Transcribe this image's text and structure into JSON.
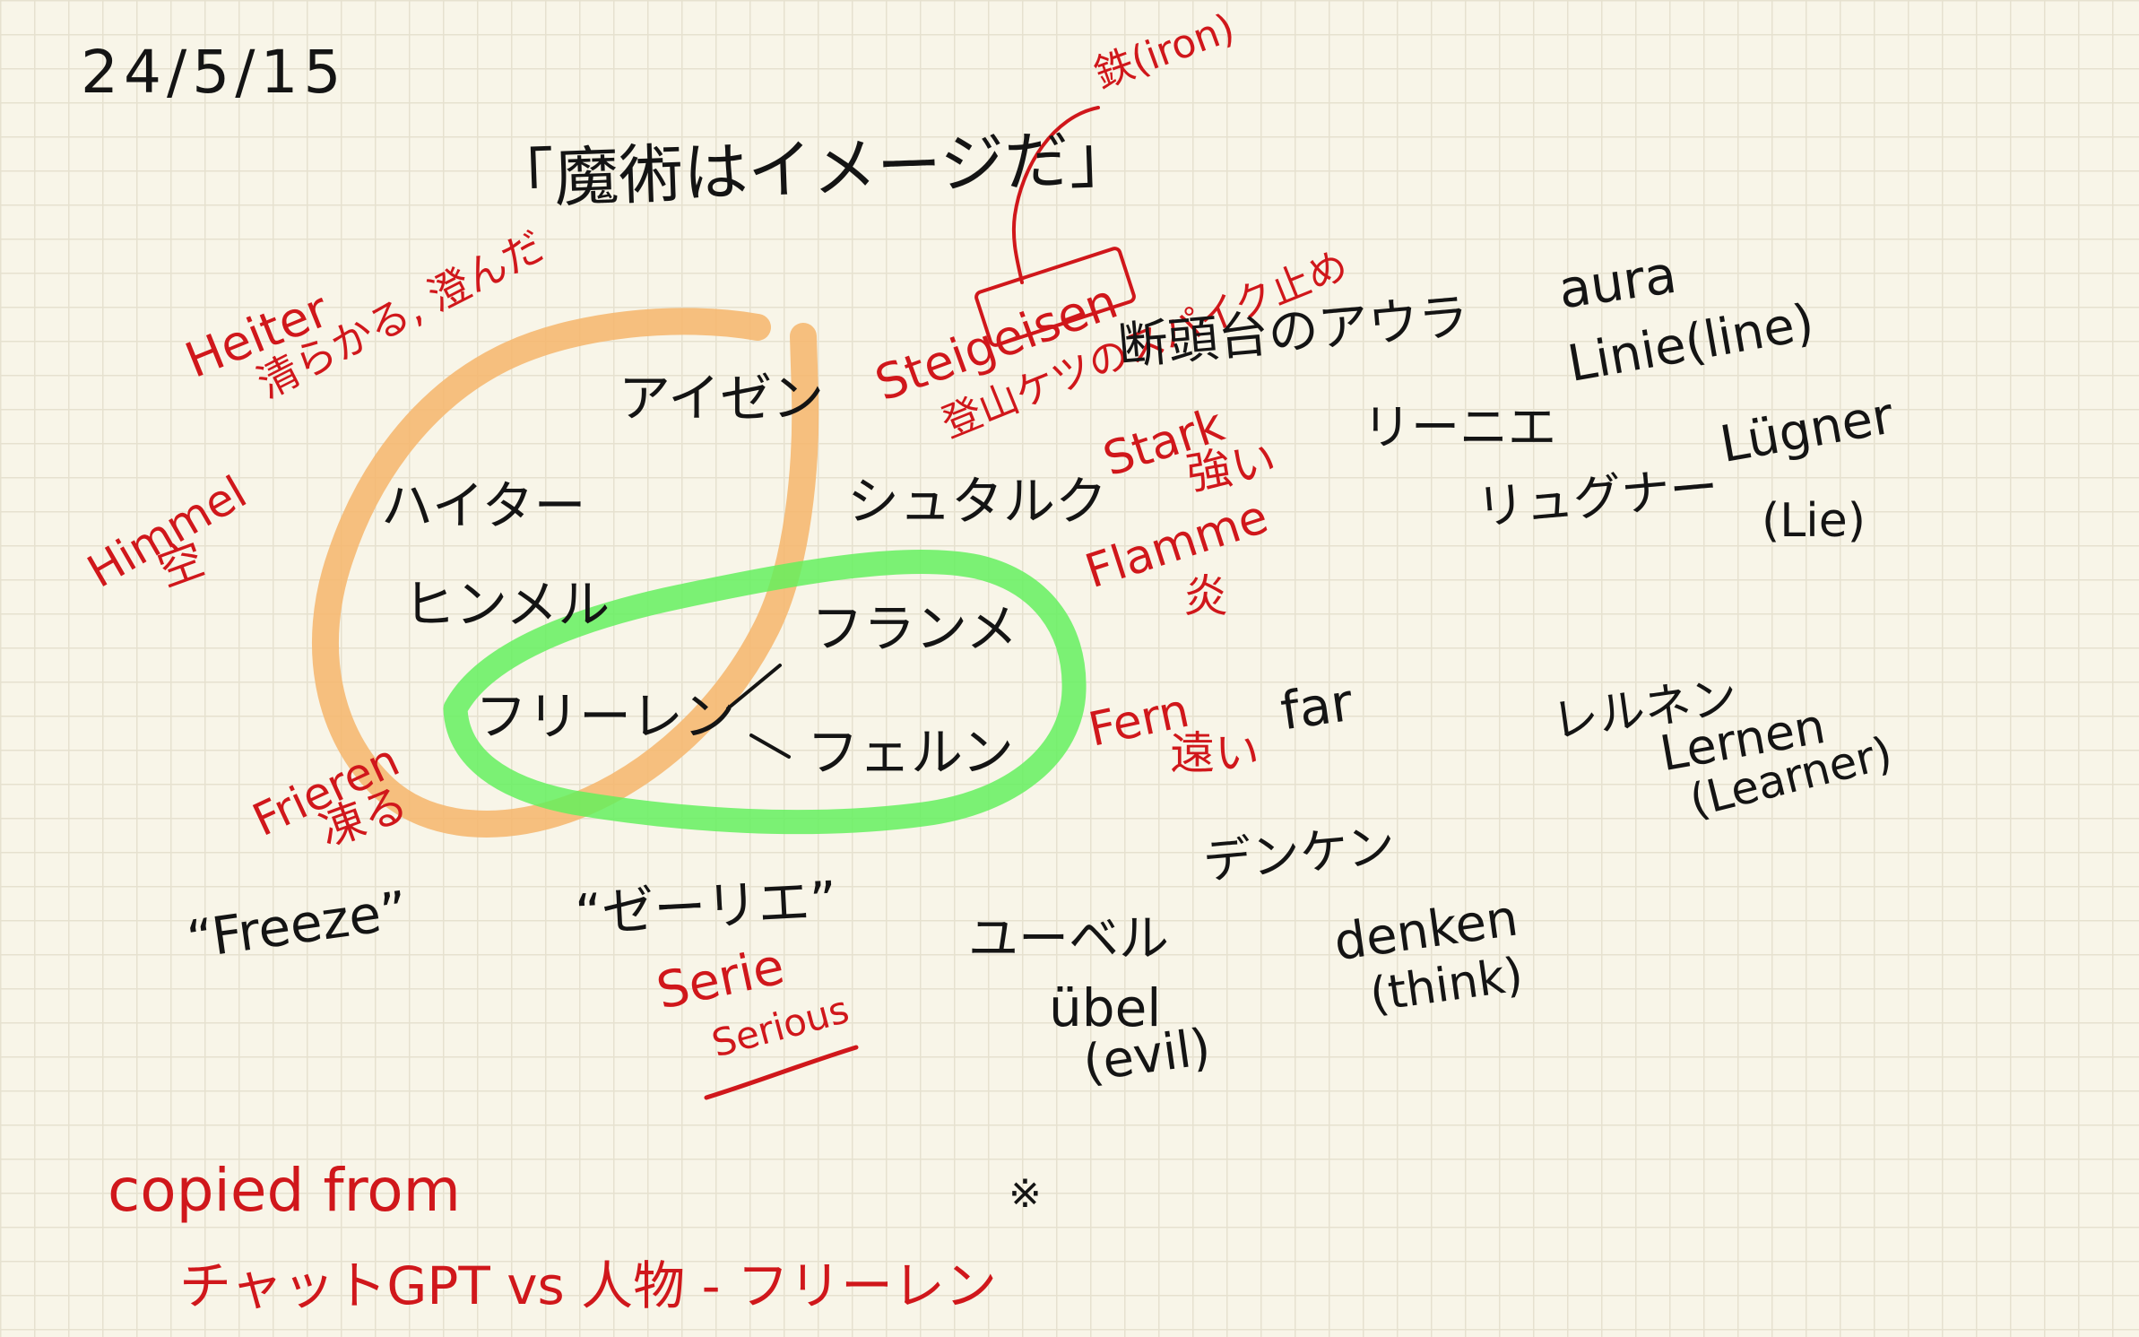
{
  "date": "24/5/15",
  "title": "「魔術はイメージだ」",
  "colors": {
    "ink": "#141414",
    "red": "#d0171b",
    "orange": "#f6b56b",
    "green": "#5ff05a",
    "paper": "#f8f5e8",
    "grid": "#e6e1cf"
  },
  "annotations": {
    "iron": "鉄(iron)",
    "steig_eisen": "Steigeisen",
    "steig_eisen_meaning": "登山ケツのスパイク止め",
    "heiter": "Heiter",
    "heiter_meaning": "清らかる, 澄んだ",
    "himmel": "Himmel",
    "himmel_meaning": "空",
    "frieren": "Frieren",
    "frieren_meaning": "凍る",
    "stark": "Stark",
    "stark_meaning": "強い",
    "flamme": "Flamme",
    "flamme_meaning": "炎",
    "fern": "Fern",
    "fern_meaning": "遠い",
    "serie": "Serie",
    "serie_sub": "Serious"
  },
  "characters": {
    "eisen": "アイゼン",
    "heiter": "ハイター",
    "himmel": "ヒンメル",
    "stark": "シュタルク",
    "flamme": "フランメ",
    "frieren": "フリーレン",
    "fern": "フェルン"
  },
  "words": {
    "aura_jp": "断頭台のアウラ",
    "aura": "aura",
    "linie_jp": "リーニエ",
    "linie": "Linie(line)",
    "lugner_jp": "リュグナー",
    "lugner": "Lügner",
    "lugner_en": "(Lie)",
    "far": "far",
    "lernen_jp": "レルネン",
    "lernen": "Lernen",
    "lernen_en": "(Learner)",
    "freeze": "“Freeze”",
    "serie_jp": "“ゼーリエ”",
    "denken_jp": "デンケン",
    "denken": "denken",
    "denken_en": "(think)",
    "ubel_jp": "ユーベル",
    "ubel": "übel",
    "ubel_en": "(evil)"
  },
  "footer": {
    "line1": "copied from",
    "line2": "チャットGPT vs 人物 - フリーレン"
  },
  "doodle": "※"
}
